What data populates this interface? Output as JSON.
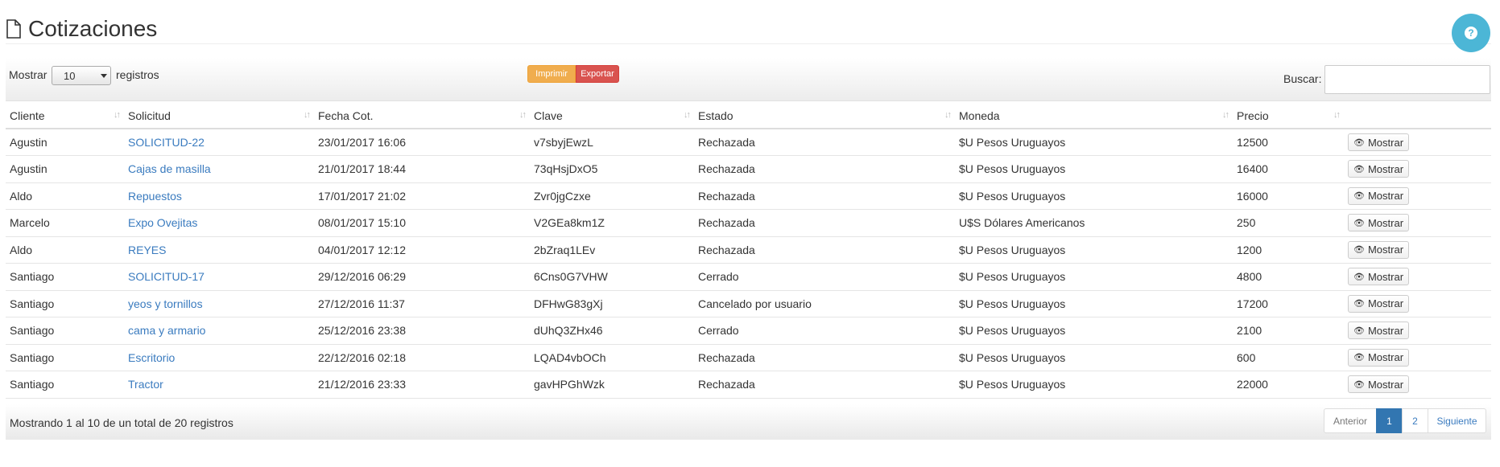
{
  "page": {
    "title": "Cotizaciones"
  },
  "toolbar": {
    "show_label": "Mostrar",
    "show_value": "10",
    "records_label": "registros",
    "print_label": "Imprimir",
    "export_label": "Exportar",
    "search_label": "Buscar:",
    "search_value": ""
  },
  "table": {
    "headers": [
      "Cliente",
      "Solicitud",
      "Fecha Cot.",
      "Clave",
      "Estado",
      "Moneda",
      "Precio",
      ""
    ],
    "action_label": "Mostrar",
    "rows": [
      {
        "cliente": "Agustin",
        "solicitud": "SOLICITUD-22",
        "fecha": "23/01/2017 16:06",
        "clave": "v7sbyjEwzL",
        "estado": "Rechazada",
        "moneda": "$U Pesos Uruguayos",
        "precio": "12500"
      },
      {
        "cliente": "Agustin",
        "solicitud": "Cajas de masilla",
        "fecha": "21/01/2017 18:44",
        "clave": "73qHsjDxO5",
        "estado": "Rechazada",
        "moneda": "$U Pesos Uruguayos",
        "precio": "16400"
      },
      {
        "cliente": "Aldo",
        "solicitud": "Repuestos",
        "fecha": "17/01/2017 21:02",
        "clave": "Zvr0jgCzxe",
        "estado": "Rechazada",
        "moneda": "$U Pesos Uruguayos",
        "precio": "16000"
      },
      {
        "cliente": "Marcelo",
        "solicitud": "Expo Ovejitas",
        "fecha": "08/01/2017 15:10",
        "clave": "V2GEa8km1Z",
        "estado": "Rechazada",
        "moneda": "U$S Dólares Americanos",
        "precio": "250"
      },
      {
        "cliente": "Aldo",
        "solicitud": "REYES",
        "fecha": "04/01/2017 12:12",
        "clave": "2bZraq1LEv",
        "estado": "Rechazada",
        "moneda": "$U Pesos Uruguayos",
        "precio": "1200"
      },
      {
        "cliente": "Santiago",
        "solicitud": "SOLICITUD-17",
        "fecha": "29/12/2016 06:29",
        "clave": "6Cns0G7VHW",
        "estado": "Cerrado",
        "moneda": "$U Pesos Uruguayos",
        "precio": "4800"
      },
      {
        "cliente": "Santiago",
        "solicitud": "yeos y tornillos",
        "fecha": "27/12/2016 11:37",
        "clave": "DFHwG83gXj",
        "estado": "Cancelado por usuario",
        "moneda": "$U Pesos Uruguayos",
        "precio": "17200"
      },
      {
        "cliente": "Santiago",
        "solicitud": "cama y armario",
        "fecha": "25/12/2016 23:38",
        "clave": "dUhQ3ZHx46",
        "estado": "Cerrado",
        "moneda": "$U Pesos Uruguayos",
        "precio": "2100"
      },
      {
        "cliente": "Santiago",
        "solicitud": "Escritorio",
        "fecha": "22/12/2016 02:18",
        "clave": "LQAD4vbOCh",
        "estado": "Rechazada",
        "moneda": "$U Pesos Uruguayos",
        "precio": "600"
      },
      {
        "cliente": "Santiago",
        "solicitud": "Tractor",
        "fecha": "21/12/2016 23:33",
        "clave": "gavHPGhWzk",
        "estado": "Rechazada",
        "moneda": "$U Pesos Uruguayos",
        "precio": "22000"
      }
    ]
  },
  "footer": {
    "info": "Mostrando 1 al 10 de un total de 20 registros",
    "prev_label": "Anterior",
    "pages": [
      "1",
      "2"
    ],
    "current_page": "1",
    "next_label": "Siguiente"
  },
  "colors": {
    "link": "#3a7bbf",
    "imprimir": "#f0ad4e",
    "exportar": "#d9534f",
    "help": "#4cb6d6",
    "active_page": "#3276b1"
  }
}
